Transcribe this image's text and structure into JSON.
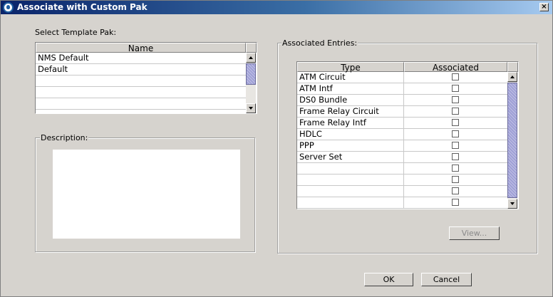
{
  "window": {
    "title": "Associate with Custom Pak",
    "close_glyph": "×"
  },
  "template_pak": {
    "label": "Select Template Pak:",
    "column_header": "Name",
    "rows": [
      "NMS Default",
      "Default",
      "",
      "",
      "",
      ""
    ]
  },
  "description": {
    "label": "Description:",
    "value": ""
  },
  "associated_entries": {
    "label": "Associated Entries:",
    "columns": [
      "Type",
      "Associated"
    ],
    "rows": [
      {
        "type": "ATM Circuit",
        "associated": false
      },
      {
        "type": "ATM Intf",
        "associated": false
      },
      {
        "type": "DS0 Bundle",
        "associated": false
      },
      {
        "type": "Frame Relay Circuit",
        "associated": false
      },
      {
        "type": "Frame Relay Intf",
        "associated": false
      },
      {
        "type": "HDLC",
        "associated": false
      },
      {
        "type": "PPP",
        "associated": false
      },
      {
        "type": "Server Set",
        "associated": false
      },
      {
        "type": "",
        "associated": false
      },
      {
        "type": "",
        "associated": false
      },
      {
        "type": "",
        "associated": false
      },
      {
        "type": "",
        "associated": false
      }
    ],
    "view_button": "View..."
  },
  "buttons": {
    "ok": "OK",
    "cancel": "Cancel"
  },
  "colors": {
    "title_gradient_start": "#0a246a",
    "dialog_background": "#d6d3ce",
    "scroll_thumb": "#9fa0d6"
  }
}
